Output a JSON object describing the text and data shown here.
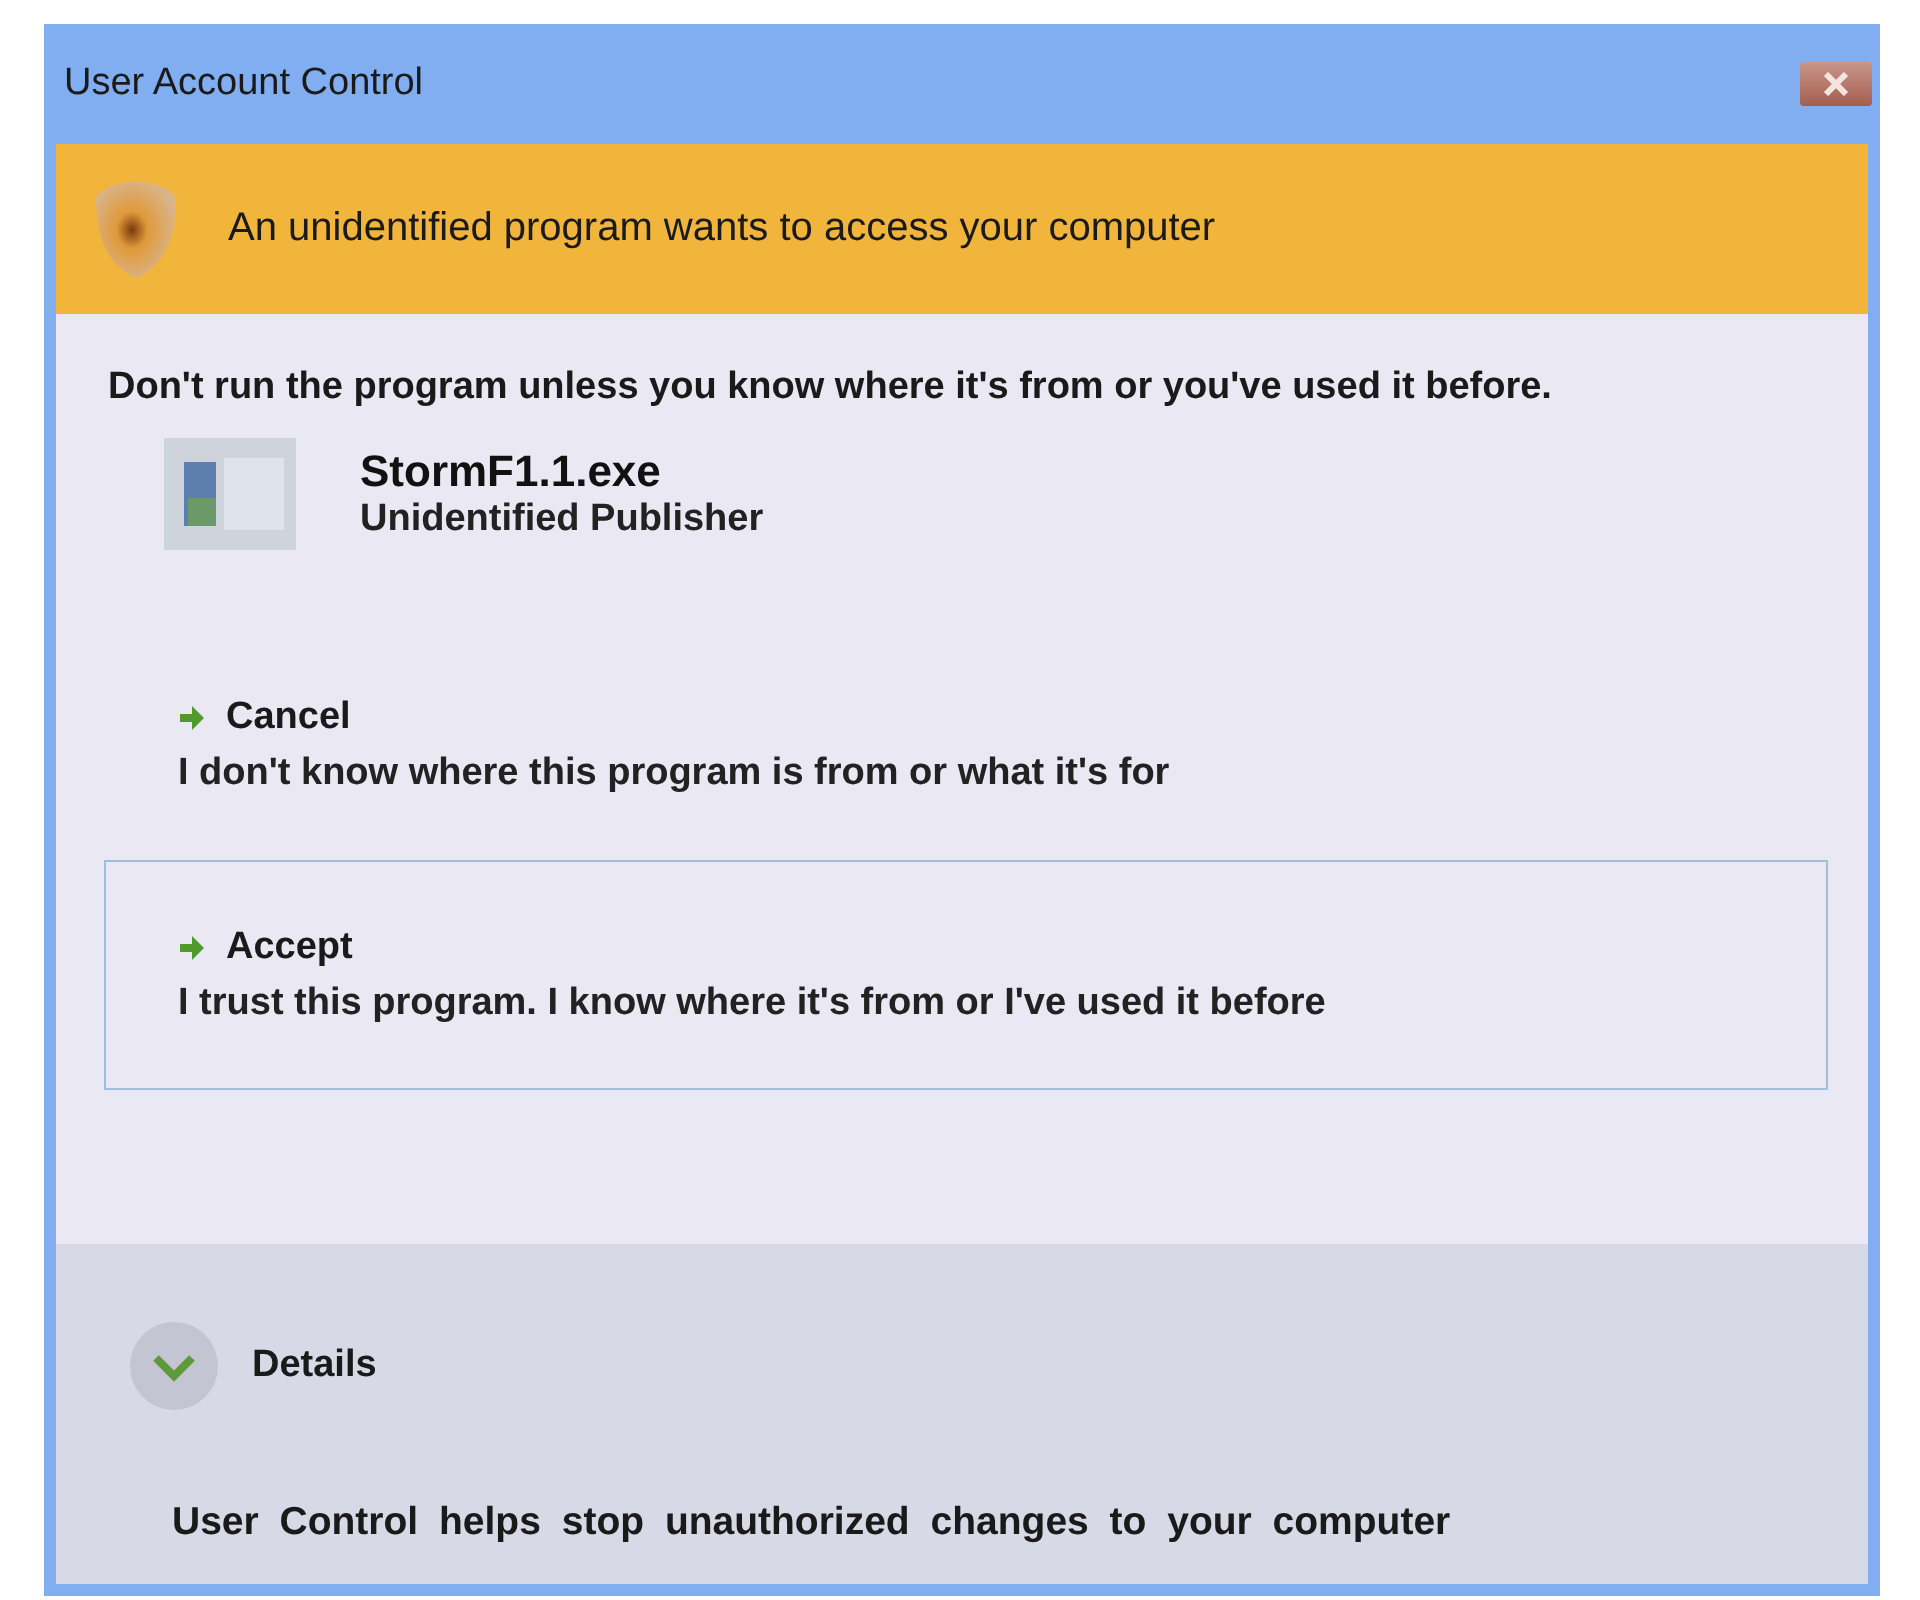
{
  "window": {
    "title": "User Account Control"
  },
  "banner": {
    "text": "An unidentified program wants to access your computer"
  },
  "warning": "Don't run the program unless you know where it's from or you've used it before.",
  "program": {
    "name": "StormF1.1.exe",
    "publisher": "Unidentified Publisher"
  },
  "options": [
    {
      "title": "Cancel",
      "description": "I don't know where this program is from or what it's for",
      "selected": false
    },
    {
      "title": "Accept",
      "description": "I trust this program. I know where it's from or I've used it before",
      "selected": true
    }
  ],
  "details": {
    "label": "Details",
    "expanded": false
  },
  "footer": "User Control helps stop unauthorized changes to your computer"
}
